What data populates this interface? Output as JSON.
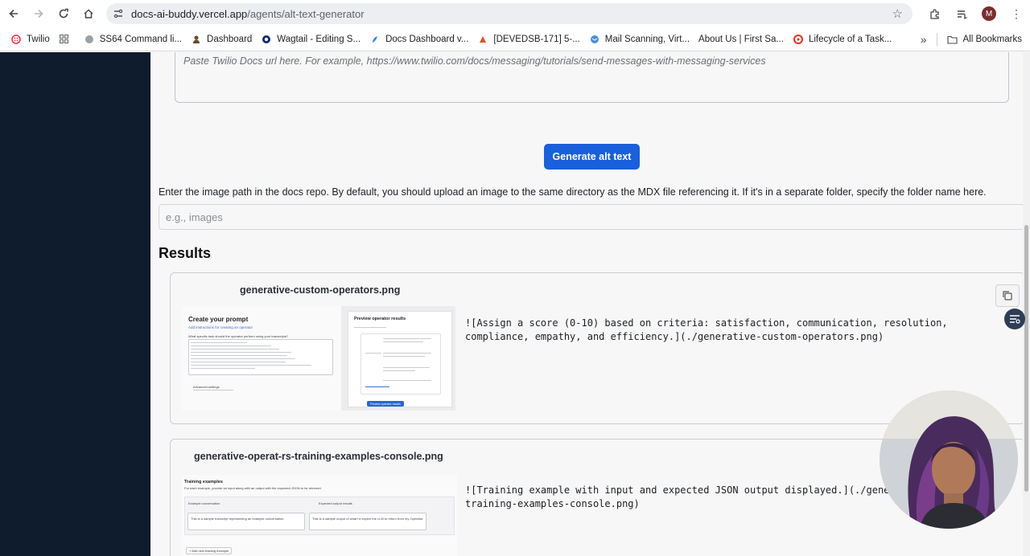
{
  "browser": {
    "url_host": "docs-ai-buddy.vercel.app",
    "url_path": "/agents/alt-text-generator",
    "profile_initial": "M",
    "bookmarks": [
      {
        "label": "Twilio",
        "icon": "twilio-icon",
        "color": "#f22f46"
      },
      {
        "label": "",
        "icon": "apps-grid-icon",
        "color": "#5f6368"
      },
      {
        "label": "SS64 Command li...",
        "icon": "globe-icon",
        "color": "#9aa0a6"
      },
      {
        "label": "Dashboard",
        "icon": "person-icon",
        "color": "#6b4a2a"
      },
      {
        "label": "Wagtail - Editing S...",
        "icon": "wagtail-icon",
        "color": "#0b2a6b"
      },
      {
        "label": "Docs Dashboard v...",
        "icon": "docs-icon",
        "color": "#3b82f6"
      },
      {
        "label": "[DEVEDSB-171] 5-...",
        "icon": "jira-icon",
        "color": "#e34f26"
      },
      {
        "label": "Mail Scanning, Virt...",
        "icon": "mail-icon",
        "color": "#4a90d9"
      },
      {
        "label": "About Us | First Sa...",
        "icon": "blank-icon",
        "color": "#ffffff"
      },
      {
        "label": "Lifecycle of a Task...",
        "icon": "lifecycle-icon",
        "color": "#e0301e"
      }
    ],
    "all_bookmarks": "All Bookmarks"
  },
  "form": {
    "url_placeholder": "Paste Twilio Docs url here. For example, https://www.twilio.com/docs/messaging/tutorials/send-messages-with-messaging-services",
    "generate_label": "Generate alt text",
    "path_help": "Enter the image path in the docs repo. By default, you should upload an image to the same directory as the MDX file referencing it. If it's in a separate folder, specify the folder name here.",
    "path_placeholder": "e.g., images"
  },
  "results": {
    "title": "Results",
    "items": [
      {
        "filename": "generative-custom-operators.png",
        "markdown_line1": "![Assign a score (0-10) based on criteria: satisfaction, communication, resolution,",
        "markdown_line2": "compliance, empathy, and efficiency.](./generative-custom-operators.png)",
        "thumb": {
          "left_title": "Create your prompt",
          "left_sub": "Add instructions for creating an operator",
          "left_q": "What specific task should the operator perform using your transcripts?",
          "advanced": "Advanced settings",
          "right_title": "Preview operator results",
          "right_button": "Preview operator results"
        }
      },
      {
        "filename": "generative-operat-rs-training-examples-console.png",
        "markdown_line1": "![Training example with input and expected JSON output displayed.](./gene",
        "markdown_line2": "training-examples-console.png)",
        "thumb": {
          "title": "Training examples",
          "sub": "For each example, provide an input along with an output with the expected JSON to be returned.",
          "col1": "Example conversation",
          "col2": "Expected output results",
          "cell1": "This is a sample transcript representing an example conversation.",
          "cell2": "This is a sample output of what I'd expect the LLM to return from my Operator.",
          "add": "+ Add new training example"
        }
      }
    ]
  }
}
